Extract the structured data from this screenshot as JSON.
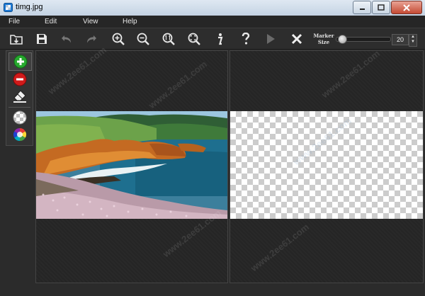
{
  "window": {
    "title": "timg.jpg"
  },
  "menu": {
    "file": "File",
    "edit": "Edit",
    "view": "View",
    "help": "Help"
  },
  "toolbar": {
    "marker_label_1": "Marker",
    "marker_label_2": "Size",
    "marker_size_value": "20",
    "marker_size_fraction": 0.0,
    "icons": [
      "open-icon",
      "save-icon",
      "undo-icon",
      "redo-icon",
      "zoom-in-icon",
      "zoom-out-icon",
      "actual-size-icon",
      "fit-icon",
      "info-icon",
      "help-icon",
      "run-icon",
      "clear-icon"
    ]
  },
  "tools": [
    "add-marker-icon",
    "remove-marker-icon",
    "eraser-icon",
    "transparent-bg-icon",
    "color-bg-icon"
  ],
  "watermark": "www.2ee61.com",
  "colors": {
    "add": "#27a82e",
    "remove": "#d01a1a",
    "background": "#2b2b2b"
  }
}
